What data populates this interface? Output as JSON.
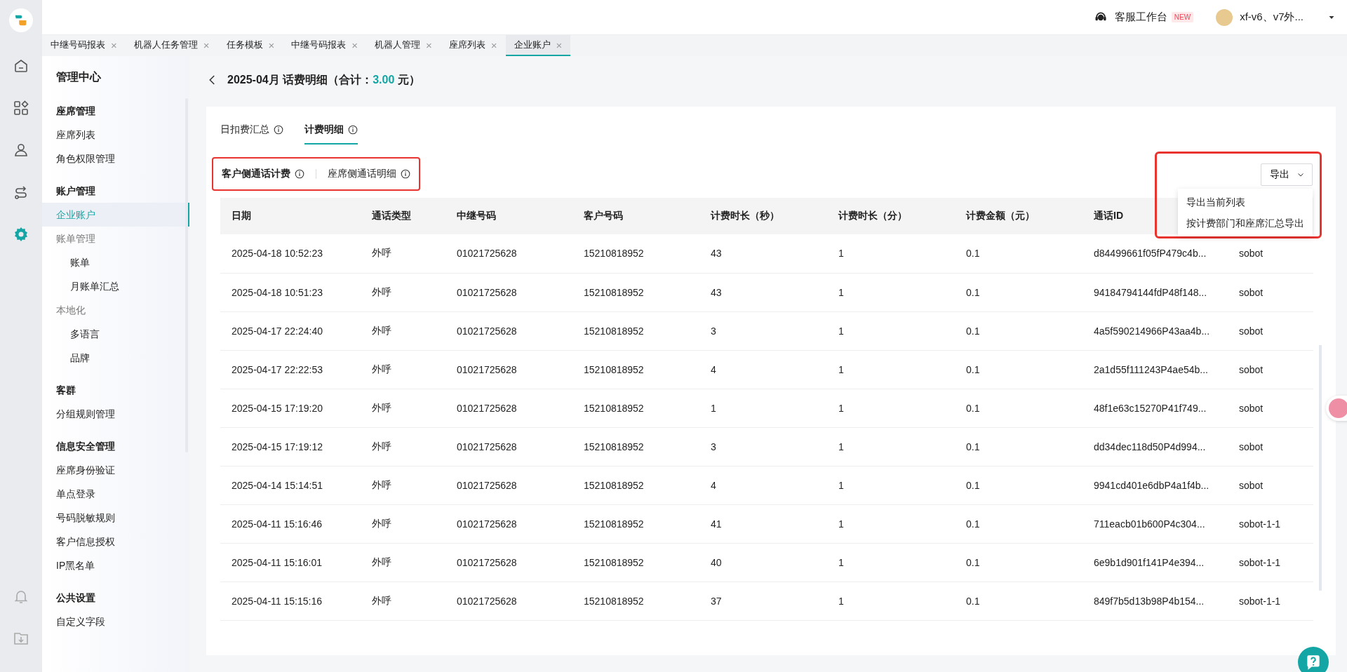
{
  "rail": {
    "items": [
      {
        "kind": "home",
        "selected": false
      },
      {
        "kind": "apps",
        "selected": false
      },
      {
        "kind": "person",
        "selected": false
      },
      {
        "kind": "route",
        "selected": false
      },
      {
        "kind": "settings",
        "selected": true
      }
    ],
    "bottom": [
      {
        "kind": "bell"
      },
      {
        "kind": "download"
      }
    ]
  },
  "topbar": {
    "workbench": "客服工作台",
    "badge": "NEW",
    "user": "xf-v6、v7外..."
  },
  "tabs": [
    {
      "label": "中继号码报表",
      "close": "×",
      "selected": false
    },
    {
      "label": "机器人任务管理",
      "close": "×",
      "selected": false
    },
    {
      "label": "任务模板",
      "close": "×",
      "selected": false
    },
    {
      "label": "中继号码报表",
      "close": "×",
      "selected": false
    },
    {
      "label": "机器人管理",
      "close": "×",
      "selected": false
    },
    {
      "label": "座席列表",
      "close": "×",
      "selected": false
    },
    {
      "label": "企业账户",
      "close": "×",
      "selected": true
    }
  ],
  "sidebar": {
    "title": "管理中心",
    "sections": [
      {
        "title": "座席管理",
        "items": [
          {
            "label": "座席列表",
            "selected": false
          },
          {
            "label": "角色权限管理",
            "selected": false
          }
        ]
      },
      {
        "title": "账户管理",
        "items": [
          {
            "label": "企业账户",
            "selected": true
          },
          {
            "label": "账单管理",
            "selected": false,
            "children": [
              {
                "label": "账单",
                "selected": false
              },
              {
                "label": "月账单汇总",
                "selected": false
              }
            ]
          },
          {
            "label": "本地化",
            "selected": false,
            "children": [
              {
                "label": "多语言",
                "selected": false
              },
              {
                "label": "品牌",
                "selected": false
              }
            ]
          }
        ]
      },
      {
        "title": "客群",
        "items": [
          {
            "label": "分组规则管理",
            "selected": false
          }
        ]
      },
      {
        "title": "信息安全管理",
        "items": [
          {
            "label": "座席身份验证",
            "selected": false
          },
          {
            "label": "单点登录",
            "selected": false
          },
          {
            "label": "号码脱敏规则",
            "selected": false
          },
          {
            "label": "客户信息授权",
            "selected": false
          },
          {
            "label": "IP黑名单",
            "selected": false
          }
        ]
      },
      {
        "title": "公共设置",
        "items": [
          {
            "label": "自定义字段",
            "selected": false
          }
        ]
      }
    ]
  },
  "page": {
    "title": "2025-04月 话费明细（合计：",
    "total": "3.00",
    "unit": "元）"
  },
  "card_tabs": [
    {
      "label": "日扣费汇总",
      "selected": false
    },
    {
      "label": "计费明细",
      "selected": true
    }
  ],
  "sub_tabs": {
    "highlighted": true,
    "items": [
      {
        "label": "客户侧通话计费",
        "selected": true
      },
      {
        "label": "座席侧通话明细",
        "selected": false
      }
    ]
  },
  "export": {
    "highlighted": true,
    "button": "导出",
    "menu": [
      "导出当前列表",
      "按计费部门和座席汇总导出"
    ]
  },
  "table": {
    "columns": [
      "日期",
      "通话类型",
      "中继号码",
      "客户号码",
      "计费时长（秒）",
      "计费时长（分）",
      "计费金额（元）",
      "通话ID"
    ],
    "rows": [
      [
        "2025-04-18 10:52:23",
        "外呼",
        "01021725628",
        "15210818952",
        "43",
        "1",
        "0.1",
        "d84499661f05fP479c4b...",
        "sobot"
      ],
      [
        "2025-04-18 10:51:23",
        "外呼",
        "01021725628",
        "15210818952",
        "43",
        "1",
        "0.1",
        "94184794144fdP48f148...",
        "sobot"
      ],
      [
        "2025-04-17 22:24:40",
        "外呼",
        "01021725628",
        "15210818952",
        "3",
        "1",
        "0.1",
        "4a5f590214966P43aa4b...",
        "sobot"
      ],
      [
        "2025-04-17 22:22:53",
        "外呼",
        "01021725628",
        "15210818952",
        "4",
        "1",
        "0.1",
        "2a1d55f111243P4ae54b...",
        "sobot"
      ],
      [
        "2025-04-15 17:19:20",
        "外呼",
        "01021725628",
        "15210818952",
        "1",
        "1",
        "0.1",
        "48f1e63c15270P41f749...",
        "sobot"
      ],
      [
        "2025-04-15 17:19:12",
        "外呼",
        "01021725628",
        "15210818952",
        "3",
        "1",
        "0.1",
        "dd34dec118d50P4d994...",
        "sobot"
      ],
      [
        "2025-04-14 15:14:51",
        "外呼",
        "01021725628",
        "15210818952",
        "4",
        "1",
        "0.1",
        "9941cd401e6dbP4a1f4b...",
        "sobot"
      ],
      [
        "2025-04-11 15:16:46",
        "外呼",
        "01021725628",
        "15210818952",
        "41",
        "1",
        "0.1",
        "711eacb01b600P4c304...",
        "sobot-1-1"
      ],
      [
        "2025-04-11 15:16:01",
        "外呼",
        "01021725628",
        "15210818952",
        "40",
        "1",
        "0.1",
        "6e9b1d901f141P4e394...",
        "sobot-1-1"
      ],
      [
        "2025-04-11 15:15:16",
        "外呼",
        "01021725628",
        "15210818952",
        "37",
        "1",
        "0.1",
        "849f7b5d13b98P4b154...",
        "sobot-1-1"
      ]
    ]
  }
}
